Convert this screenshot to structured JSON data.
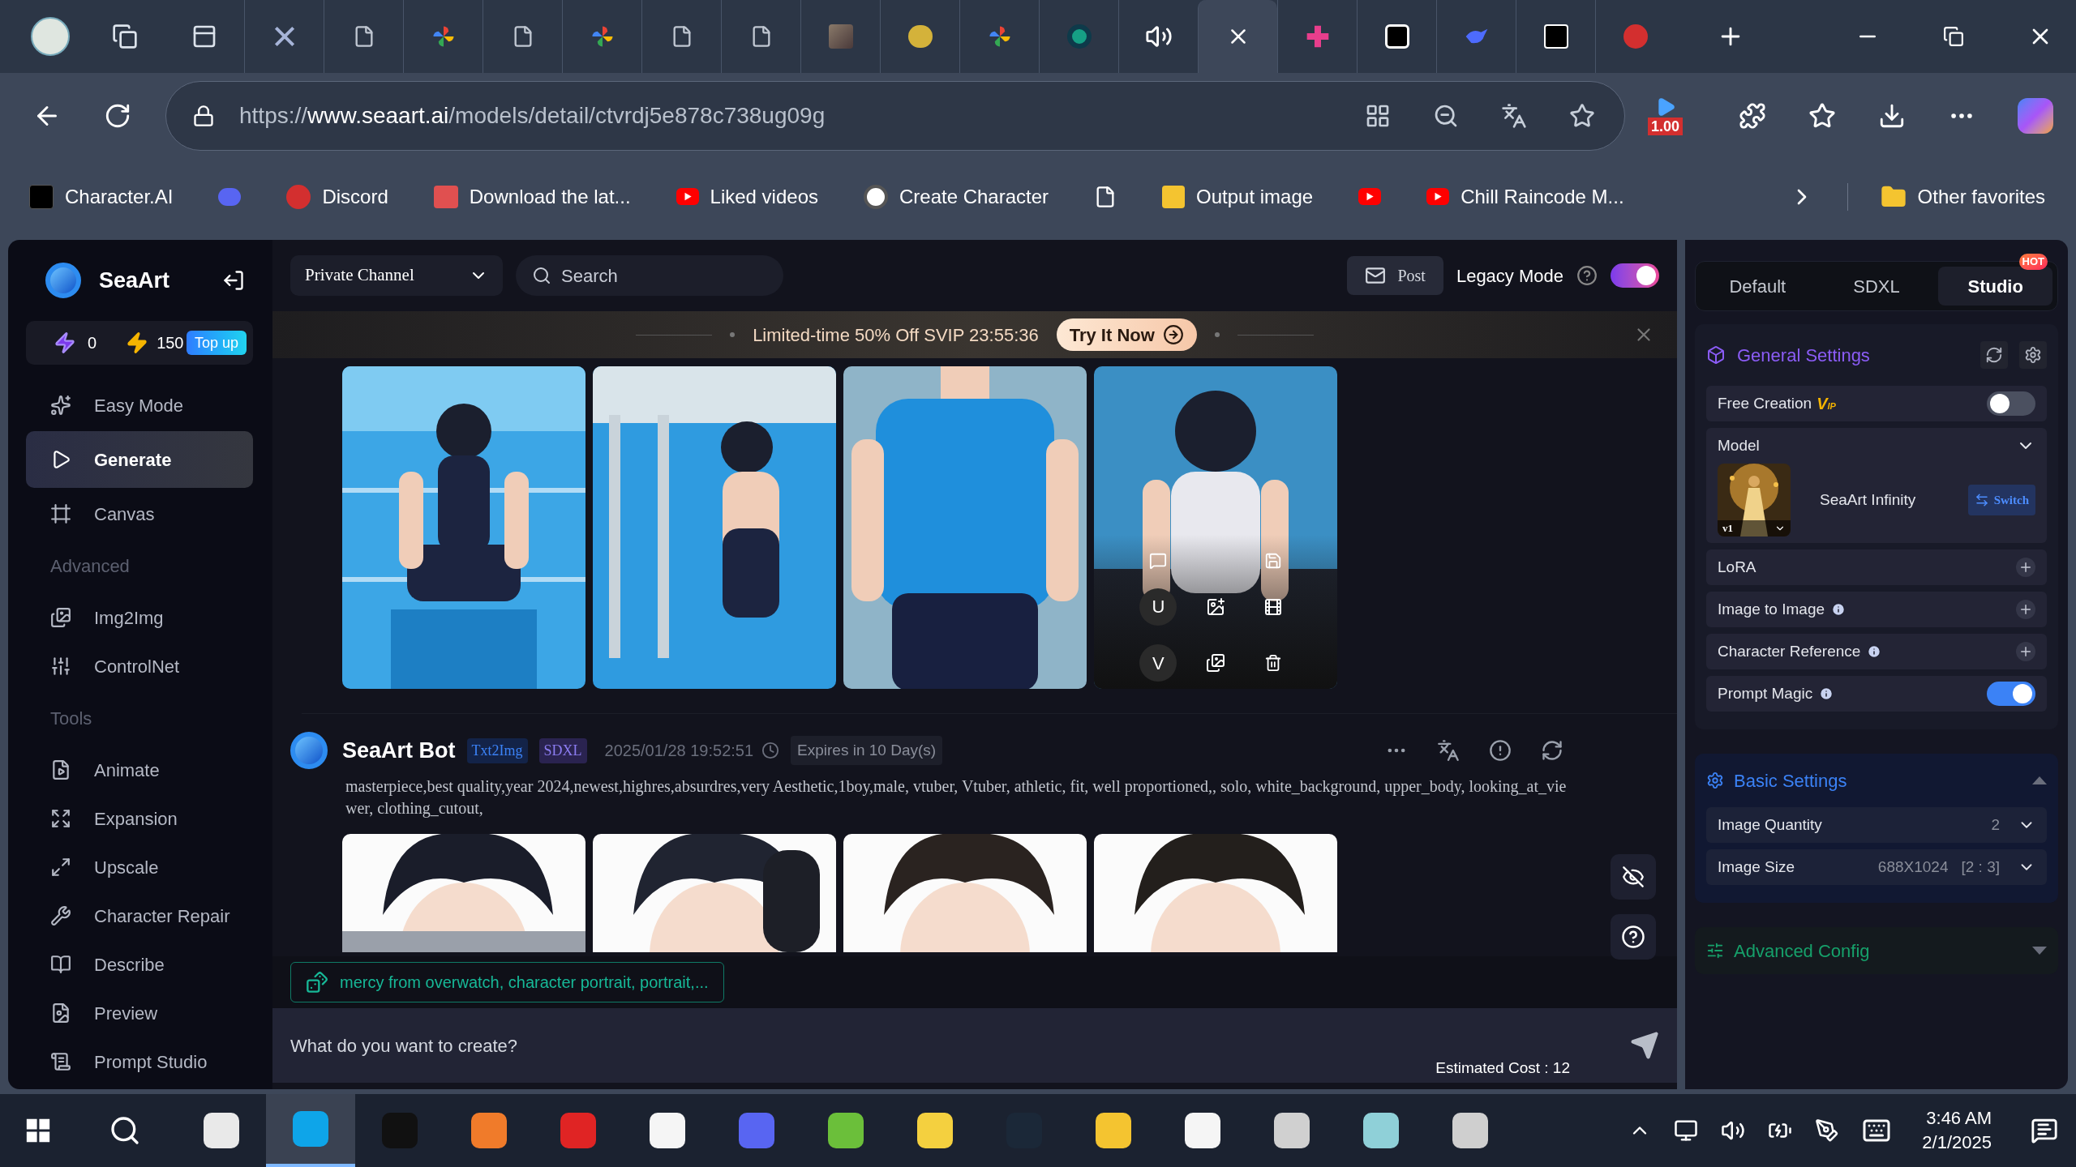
{
  "browser": {
    "tabs": [
      {
        "selected": false
      },
      {
        "selected": false
      },
      {
        "selected": false
      },
      {
        "selected": false
      },
      {
        "selected": false
      },
      {
        "selected": false
      },
      {
        "selected": false
      },
      {
        "selected": false
      },
      {
        "selected": false
      },
      {
        "selected": false
      },
      {
        "selected": false
      },
      {
        "selected": false
      },
      {
        "selected": true
      },
      {
        "selected": false
      },
      {
        "selected": false
      },
      {
        "selected": false
      },
      {
        "selected": false
      },
      {
        "selected": false
      }
    ],
    "url": {
      "scheme": "https://",
      "host": "www.seaart.ai",
      "path": "/models/detail/ctvrdj5e878c738ug09g"
    },
    "extension_badge": "1.00",
    "bookmarks": [
      {
        "kind": "link",
        "label": "Character.AI"
      },
      {
        "kind": "icon"
      },
      {
        "kind": "link",
        "label": "Discord"
      },
      {
        "kind": "link",
        "label": "Download the lat..."
      },
      {
        "kind": "link",
        "label": "Liked videos"
      },
      {
        "kind": "link",
        "label": "Create Character"
      },
      {
        "kind": "icon"
      },
      {
        "kind": "link",
        "label": "Output image"
      },
      {
        "kind": "icon"
      },
      {
        "kind": "link",
        "label": "Chill Raincode M..."
      }
    ],
    "other_favorites": "Other favorites"
  },
  "sidebar": {
    "brand": "SeaArt",
    "credits": [
      {
        "value": "0"
      },
      {
        "value": "150"
      }
    ],
    "top_up": "Top up",
    "items": [
      {
        "kind": "item",
        "label": "Easy Mode",
        "selected": false
      },
      {
        "kind": "item",
        "label": "Generate",
        "selected": true
      },
      {
        "kind": "item",
        "label": "Canvas",
        "selected": false
      },
      {
        "kind": "header",
        "label": "Advanced"
      },
      {
        "kind": "item",
        "label": "Img2Img",
        "selected": false
      },
      {
        "kind": "item",
        "label": "ControlNet",
        "selected": false
      },
      {
        "kind": "header",
        "label": "Tools"
      },
      {
        "kind": "item",
        "label": "Animate",
        "selected": false
      },
      {
        "kind": "item",
        "label": "Expansion",
        "selected": false
      },
      {
        "kind": "item",
        "label": "Upscale",
        "selected": false
      },
      {
        "kind": "item",
        "label": "Character Repair",
        "selected": false
      },
      {
        "kind": "item",
        "label": "Describe",
        "selected": false
      },
      {
        "kind": "item",
        "label": "Preview",
        "selected": false
      },
      {
        "kind": "item",
        "label": "Prompt Studio",
        "selected": false
      }
    ]
  },
  "topbar": {
    "channel": "Private Channel",
    "search_placeholder": "Search",
    "post": "Post",
    "legacy_mode": {
      "label": "Legacy Mode",
      "on": true
    }
  },
  "banner": {
    "text": "Limited-time 50% Off SVIP 23:55:36",
    "button": "Try It Now"
  },
  "thread": {
    "first_images": [
      {
        "kind": "picture",
        "hovered": false
      },
      {
        "kind": "picture",
        "hovered": false
      },
      {
        "kind": "picture",
        "hovered": false
      },
      {
        "kind": "picture",
        "hovered": true
      }
    ],
    "hover_labels": [
      "U",
      "V"
    ],
    "message": {
      "author": "SeaArt Bot",
      "tags": [
        "Txt2Img",
        "SDXL"
      ],
      "timestamp": "2025/01/28 19:52:51",
      "expires": "Expires in 10 Day(s)",
      "prompt": "masterpiece,best quality,year 2024,newest,highres,absurdres,very Aesthetic,1boy,male, vtuber, Vtuber, athletic, fit, well proportioned,, solo, white_background, upper_body, looking_at_viewer, clothing_cutout,",
      "images": [
        {
          "kind": "picture"
        },
        {
          "kind": "picture"
        },
        {
          "kind": "picture"
        },
        {
          "kind": "picture"
        }
      ]
    }
  },
  "suggestion": "mercy from overwatch, character portrait, portrait,...",
  "composer": {
    "placeholder": "What do you want to create?",
    "cost": "Estimated Cost : 12"
  },
  "panel": {
    "tabs": [
      {
        "label": "Default",
        "selected": false
      },
      {
        "label": "SDXL",
        "selected": false
      },
      {
        "label": "Studio",
        "selected": true,
        "badge": "HOT"
      }
    ],
    "general": {
      "title": "General Settings",
      "free_creation": {
        "label": "Free Creation",
        "vip": "V",
        "vip_small": "IP",
        "on": false
      },
      "model": {
        "label": "Model",
        "name": "SeaArt Infinity",
        "version": "v1",
        "switch": "Switch"
      },
      "rows": [
        {
          "kind": "add",
          "label": "LoRA",
          "info": false
        },
        {
          "kind": "add",
          "label": "Image to Image",
          "info": true
        },
        {
          "kind": "add",
          "label": "Character Reference",
          "info": true
        },
        {
          "kind": "toggle",
          "label": "Prompt Magic",
          "info": true,
          "on": true
        }
      ]
    },
    "basic": {
      "title": "Basic Settings",
      "expanded": true,
      "rows": [
        {
          "label": "Image Quantity",
          "value": "2"
        },
        {
          "label": "Image Size",
          "value": "688X1024",
          "ratio": "[2 : 3]"
        }
      ]
    },
    "advanced": {
      "title": "Advanced Config",
      "expanded": false
    }
  },
  "taskbar": {
    "apps": [
      {
        "selected": false
      },
      {
        "selected": true
      },
      {
        "selected": false
      },
      {
        "selected": false
      },
      {
        "selected": false
      },
      {
        "selected": false
      },
      {
        "selected": false
      },
      {
        "selected": false
      },
      {
        "selected": false
      },
      {
        "selected": false
      },
      {
        "selected": false
      },
      {
        "selected": false
      },
      {
        "selected": false
      },
      {
        "selected": false
      },
      {
        "selected": false
      }
    ],
    "time": "3:46 AM",
    "date": "2/1/2025"
  }
}
